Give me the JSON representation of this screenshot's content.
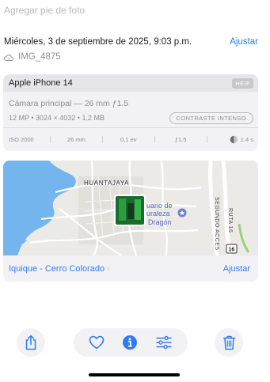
{
  "caption": {
    "placeholder": "Agregar pie de foto"
  },
  "info": {
    "datetime": "Miércoles, 3 de septiembre de 2025, 9:03 p.m.",
    "adjust": "Ajustar",
    "filename": "IMG_4875"
  },
  "camera": {
    "device": "Apple iPhone 14",
    "format": "HEIF",
    "lens": "Cámara principal — 26 mm ƒ1.5",
    "specs": "12 MP  •  3024 × 4032  •  1,2 MB",
    "style": "CONTRASTE INTENSO",
    "iso": "ISO 2000",
    "focal": "26 mm",
    "ev": "0,1 ev",
    "aperture": "ƒ1.5",
    "shutter": "1.4 s"
  },
  "map": {
    "area_label": "HUANTAJAYA",
    "poi_label_1": "uario de",
    "poi_label_2": "uraleza",
    "poi_label_3": "Dragón",
    "street_1": "SEGUNDO ACCES",
    "street_2": "RUTA 16",
    "route_number": "16",
    "place": "Iquique - Cerro Colorado",
    "adjust": "Ajustar"
  },
  "toolbar": {
    "share": "share-icon",
    "favorite": "heart-icon",
    "info": "info-icon",
    "edit": "sliders-icon",
    "delete": "trash-icon"
  },
  "colors": {
    "accent": "#2f7cf6",
    "poi": "#6f7fd8",
    "sea": "#73b5ec"
  }
}
